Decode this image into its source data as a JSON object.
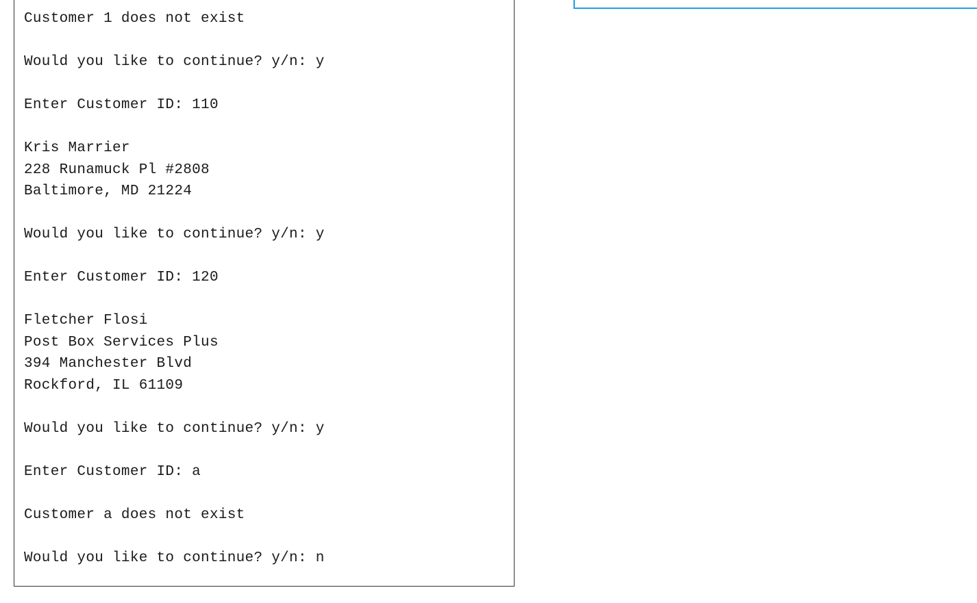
{
  "console": {
    "lines": [
      "Customer 1 does not exist",
      "",
      "Would you like to continue? y/n: y",
      "",
      "Enter Customer ID: 110",
      "",
      "Kris Marrier",
      "228 Runamuck Pl #2808",
      "Baltimore, MD 21224",
      "",
      "Would you like to continue? y/n: y",
      "",
      "Enter Customer ID: 120",
      "",
      "Fletcher Flosi",
      "Post Box Services Plus",
      "394 Manchester Blvd",
      "Rockford, IL 61109",
      "",
      "Would you like to continue? y/n: y",
      "",
      "Enter Customer ID: a",
      "",
      "Customer a does not exist",
      "",
      "Would you like to continue? y/n: n"
    ]
  }
}
